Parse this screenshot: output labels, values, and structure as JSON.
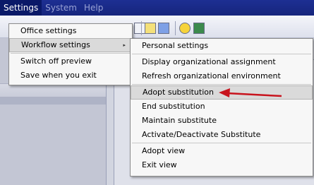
{
  "menubar": {
    "items": [
      "Settings",
      "System",
      "Help"
    ]
  },
  "settings_menu": {
    "items": [
      {
        "label": "Office settings"
      },
      {
        "label": "Workflow settings"
      },
      {
        "label": "Switch off preview"
      },
      {
        "label": "Save when you exit"
      }
    ],
    "submenu_marker": "▸"
  },
  "workflow_submenu": {
    "items": [
      {
        "label": "Personal settings"
      },
      {
        "label": "Display organizational assignment"
      },
      {
        "label": "Refresh organizational environment"
      },
      {
        "label": "Adopt substitution"
      },
      {
        "label": "End substitution"
      },
      {
        "label": "Maintain substitute"
      },
      {
        "label": "Activate/Deactivate Substitute"
      },
      {
        "label": "Adopt view"
      },
      {
        "label": "Exit view"
      }
    ]
  },
  "annotation": {
    "color": "#c8141e"
  }
}
